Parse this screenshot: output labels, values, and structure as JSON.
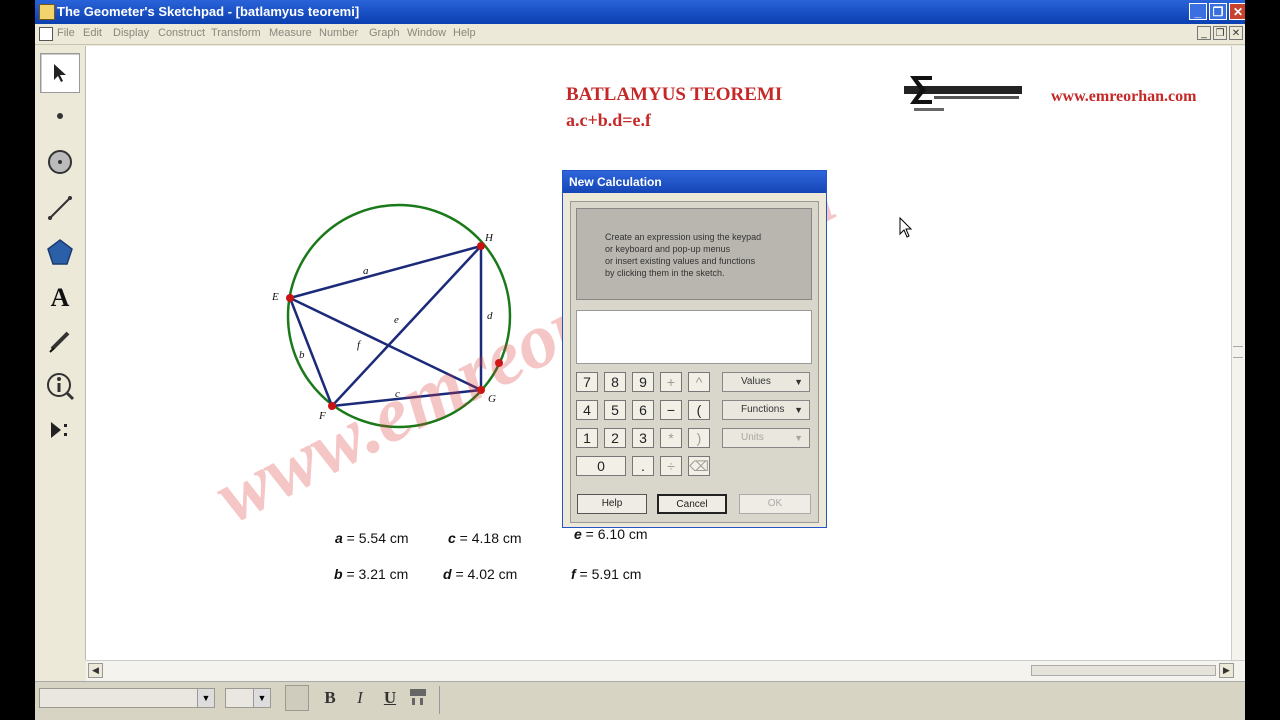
{
  "window": {
    "title": "The Geometer's Sketchpad - [batlamyus teoremi]",
    "controls": {
      "minimize": "_",
      "restore": "❐",
      "close": "✕"
    },
    "doc_controls": {
      "minimize": "_",
      "restore": "❐",
      "close": "✕"
    }
  },
  "menu": [
    "File",
    "Edit",
    "Display",
    "Construct",
    "Transform",
    "Measure",
    "Number",
    "Graph",
    "Window",
    "Help"
  ],
  "toolbox": [
    "arrow-select-icon",
    "point-tool-icon",
    "compass-tool-icon",
    "straightedge-tool-icon",
    "polygon-tool-icon",
    "text-tool-icon",
    "marker-tool-icon",
    "information-tool-icon",
    "custom-tool-icon"
  ],
  "sketch": {
    "heading": "BATLAMYUS TEOREMI",
    "formula": "a.c+b.d=e.f",
    "site": "www.emreorhan.com",
    "watermark": "www.emreorhan.com",
    "points": {
      "E": "E",
      "F": "F",
      "G": "G",
      "H": "H"
    },
    "segments": {
      "a": "a",
      "b": "b",
      "c": "c",
      "d": "d",
      "e": "e",
      "f": "f"
    },
    "colors": {
      "circle": "#1a7a1a",
      "segments": "#1c2a7a",
      "points": "#cc1111",
      "accent": "#c62828"
    },
    "measurements": [
      {
        "var": "a",
        "text": " = 5.54 cm"
      },
      {
        "var": "c",
        "text": " = 4.18 cm"
      },
      {
        "var": "e",
        "text": " = 6.10 cm"
      },
      {
        "var": "b",
        "text": " = 3.21 cm"
      },
      {
        "var": "d",
        "text": " = 4.02 cm"
      },
      {
        "var": "f",
        "text": " = 5.91 cm"
      }
    ]
  },
  "dialog": {
    "title": "New Calculation",
    "instructions": [
      "Create an expression using the keypad",
      "or keyboard and pop-up menus",
      "or insert existing values and functions",
      "by clicking them in the sketch."
    ],
    "expression": "",
    "keys": [
      "7",
      "8",
      "9",
      "+",
      "^",
      "4",
      "5",
      "6",
      "−",
      "(",
      "1",
      "2",
      "3",
      "*",
      ")",
      "0",
      ".",
      "÷",
      "⌫"
    ],
    "menus": {
      "values": "Values",
      "functions": "Functions",
      "units": "Units"
    },
    "buttons": {
      "help": "Help",
      "cancel": "Cancel",
      "ok": "OK"
    }
  },
  "format_bar": {
    "bold": "B",
    "italic": "I",
    "underline": "U"
  }
}
